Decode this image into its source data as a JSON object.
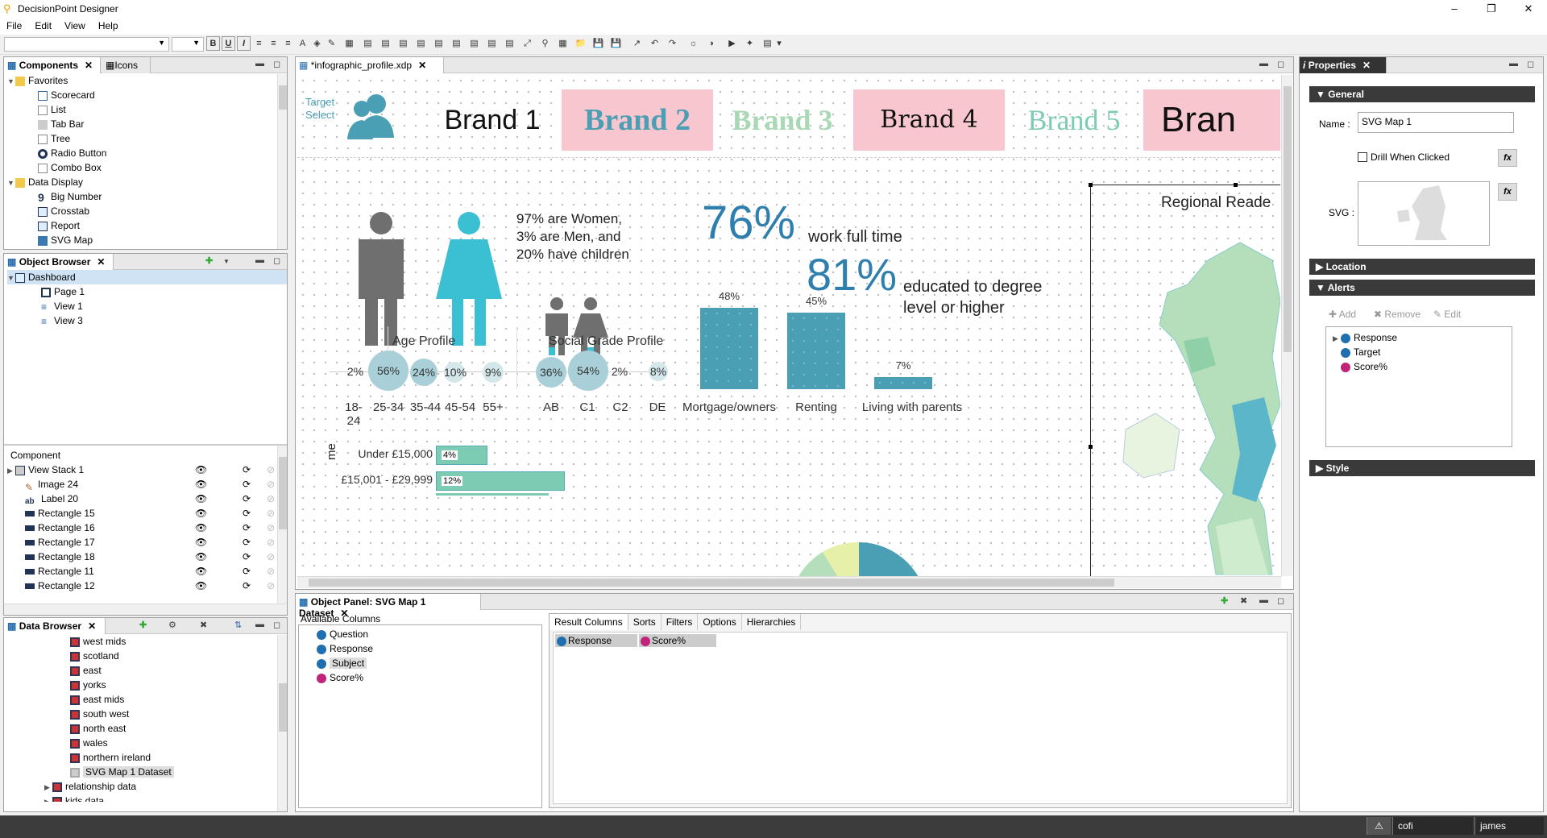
{
  "app": {
    "title": "DecisionPoint Designer",
    "menus": [
      "File",
      "Edit",
      "View",
      "Help"
    ]
  },
  "components_panel": {
    "tab1": "Components",
    "tab2": "Icons",
    "favorites": "Favorites",
    "fav_items": [
      "Scorecard",
      "List",
      "Tab Bar",
      "Tree",
      "Radio Button",
      "Combo Box"
    ],
    "data_display": "Data Display",
    "dd_items": [
      "Big Number",
      "Crosstab",
      "Report",
      "SVG Map"
    ]
  },
  "object_browser": {
    "tab": "Object Browser",
    "items": [
      "Dashboard",
      "Page 1",
      "View 1",
      "View 3"
    ]
  },
  "component_list": {
    "header": "Component",
    "items": [
      "View Stack 1",
      "Image 24",
      "Label 20",
      "Rectangle 15",
      "Rectangle 16",
      "Rectangle 17",
      "Rectangle 18",
      "Rectangle 11",
      "Rectangle 12"
    ]
  },
  "data_browser": {
    "tab": "Data Browser",
    "items": [
      "west mids",
      "scotland",
      "east",
      "yorks",
      "east mids",
      "south west",
      "north east",
      "wales",
      "northern ireland",
      "SVG Map 1 Dataset",
      "relationship data",
      "kids data"
    ]
  },
  "editor": {
    "tab": "*infographic_profile.xdp",
    "target_select": [
      "Target",
      "Select"
    ],
    "brands": [
      "Brand 1",
      "Brand 2",
      "Brand 3",
      "Brand 4",
      "Brand 5",
      "Bran"
    ],
    "gender_text": [
      "97% are Women,",
      "3% are Men, and",
      "20% have children"
    ],
    "stat1_value": "76%",
    "stat1_text": "work full time",
    "stat2_value": "81%",
    "stat2_text": [
      "educated to degree",
      "level or higher"
    ],
    "map_title": "Regional Reade",
    "age_title": "Age Profile",
    "age_values": [
      "2%",
      "56%",
      "24%",
      "10%",
      "9%"
    ],
    "age_labels": [
      "18-24",
      "25-34",
      "35-44",
      "45-54",
      "55+"
    ],
    "social_title": "Social Grade Profile",
    "social_values": [
      "36%",
      "54%",
      "2%",
      "8%"
    ],
    "social_labels": [
      "AB",
      "C1",
      "C2",
      "DE"
    ],
    "housing": {
      "values": [
        "48%",
        "45%",
        "7%"
      ],
      "labels": [
        "Mortgage/owners",
        "Renting",
        "Living with parents"
      ],
      "fractions": [
        0.48,
        0.45,
        0.07
      ]
    },
    "income_axis": "me",
    "income": [
      {
        "label": "Under £15,000",
        "value": "4%"
      },
      {
        "label": "£15,001 - £29,999",
        "value": "12%"
      }
    ]
  },
  "object_panel": {
    "tab": "Object Panel: SVG Map 1 Dataset",
    "available": "Available Columns",
    "columns": [
      "Question",
      "Response",
      "Subject",
      "Score%"
    ],
    "result_tabs": [
      "Result Columns",
      "Sorts",
      "Filters",
      "Options",
      "Hierarchies"
    ],
    "result_items": [
      "Response",
      "Score%"
    ]
  },
  "properties": {
    "tab": "Properties",
    "general": "General",
    "name_label": "Name :",
    "name_value": "SVG Map 1",
    "drill_label": "Drill When Clicked",
    "svg_label": "SVG :",
    "fx": "fx",
    "location": "Location",
    "alerts": "Alerts",
    "add": "Add",
    "remove": "Remove",
    "edit": "Edit",
    "alert_items": [
      "Response",
      "Target",
      "Score%"
    ],
    "style": "Style"
  },
  "status": {
    "user1": "cofi",
    "user2": "james"
  },
  "colors": {
    "teal": "#4a9fb4",
    "women": "#3bbfd3",
    "men": "#6f6f6f",
    "stat": "#2f7fae",
    "pink": "#f7c6cf",
    "green_text": "#a8d8b4"
  }
}
